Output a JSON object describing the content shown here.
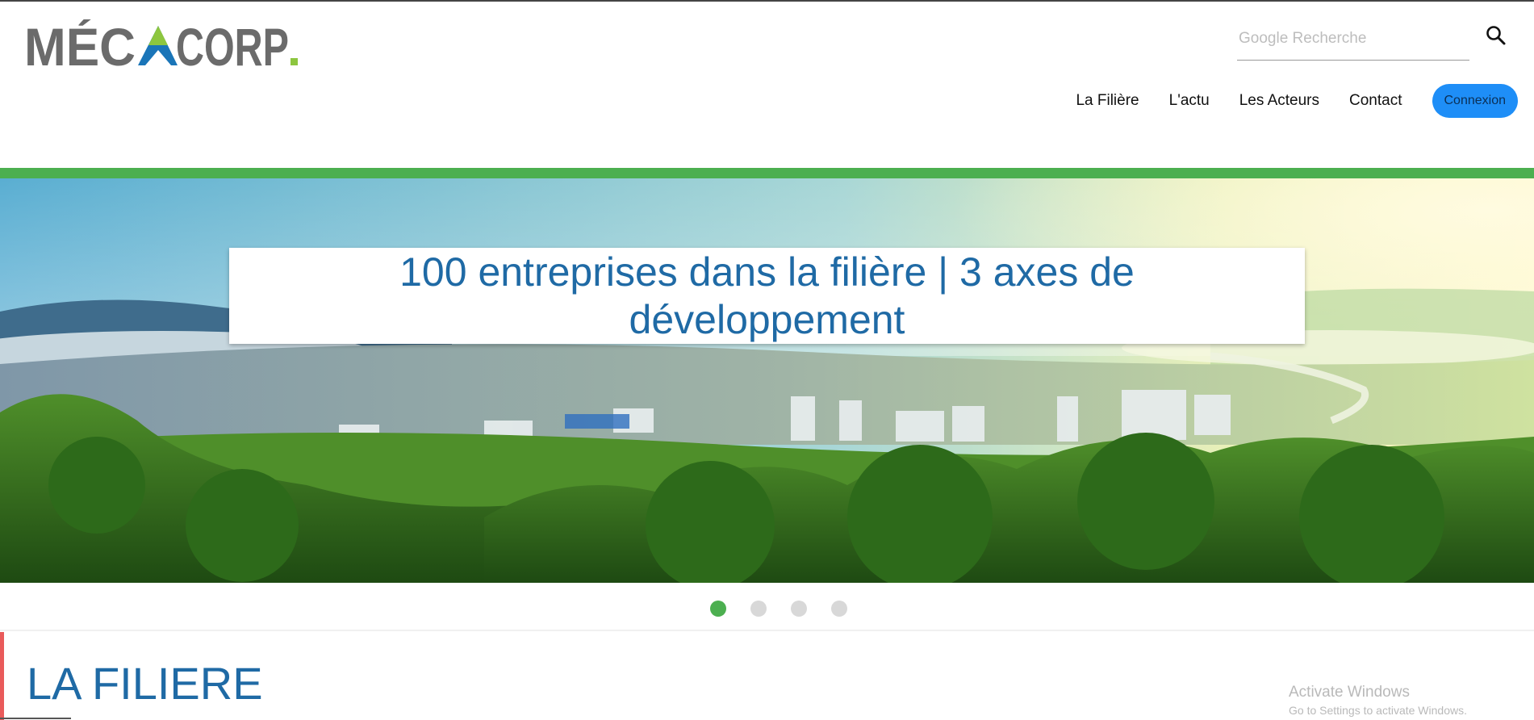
{
  "brand": {
    "logo_text": "MÉCA CORP.",
    "logo_gray": "#6b6b6b",
    "logo_blue": "#1a75b8",
    "logo_green": "#8dc63f"
  },
  "search": {
    "placeholder": "Google Recherche",
    "value": "",
    "icon": "search-icon"
  },
  "nav": {
    "items": [
      "La Filière",
      "L'actu",
      "Les Acteurs",
      "Contact"
    ],
    "login_label": "Connexion"
  },
  "colors": {
    "accent_green": "#4caf50",
    "accent_blue": "#1f6aa5",
    "button_blue": "#1e8ef7",
    "section_red": "#e95a5a"
  },
  "hero": {
    "caption": "100 entreprises dans la filière | 3 axes de développement",
    "carousel": {
      "slide_count": 4,
      "active_slide": 1
    }
  },
  "section": {
    "title": "LA FILIERE"
  },
  "os_watermark": {
    "title": "Activate Windows",
    "subtitle": "Go to Settings to activate Windows."
  }
}
